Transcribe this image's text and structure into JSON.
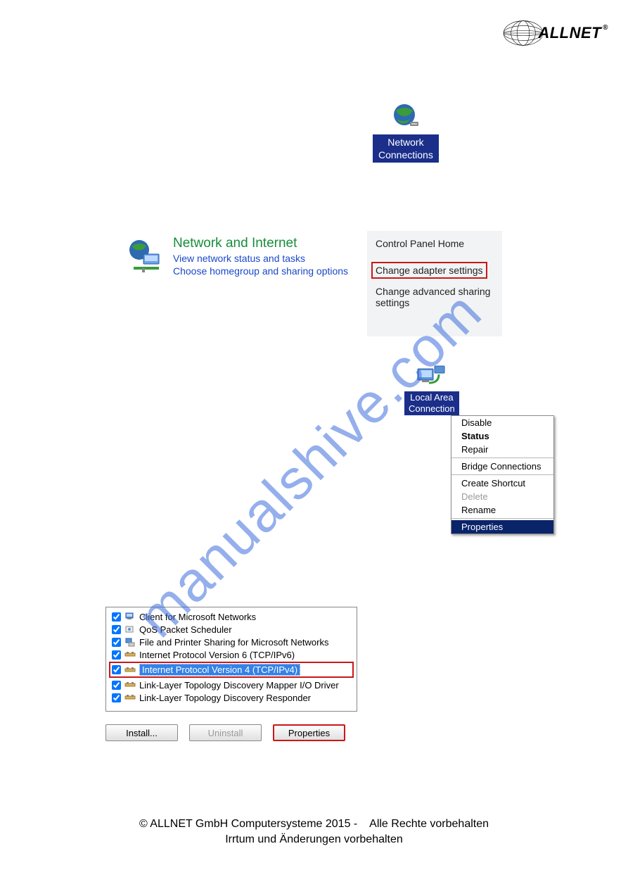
{
  "logo": {
    "brand": "ALLNET",
    "registered": "®"
  },
  "network_connections": {
    "line1": "Network",
    "line2": "Connections"
  },
  "network_internet": {
    "title": "Network and Internet",
    "link1": "View network status and tasks",
    "link2": "Choose homegroup and sharing options"
  },
  "control_panel_sidebar": {
    "home": "Control Panel Home",
    "adapter": "Change adapter settings",
    "advanced": "Change advanced sharing settings"
  },
  "lan": {
    "line1": "Local Area",
    "line2": "Connection"
  },
  "context_menu": {
    "disable": "Disable",
    "status": "Status",
    "repair": "Repair",
    "bridge": "Bridge Connections",
    "shortcut": "Create Shortcut",
    "delete": "Delete",
    "rename": "Rename",
    "properties": "Properties"
  },
  "protocols": [
    {
      "label": "Client for Microsoft Networks"
    },
    {
      "label": "QoS Packet Scheduler"
    },
    {
      "label": "File and Printer Sharing for Microsoft Networks"
    },
    {
      "label": "Internet Protocol Version 6 (TCP/IPv6)"
    },
    {
      "label": "Internet Protocol Version 4 (TCP/IPv4)"
    },
    {
      "label": "Link-Layer Topology Discovery Mapper I/O Driver"
    },
    {
      "label": "Link-Layer Topology Discovery Responder"
    }
  ],
  "buttons": {
    "install": "Install...",
    "uninstall": "Uninstall",
    "properties": "Properties"
  },
  "footer": {
    "line1_a": "© ALLNET GmbH Computersysteme 2015 -",
    "line1_b": "Alle Rechte vorbehalten",
    "line2": "Irrtum und Änderungen vorbehalten"
  },
  "watermark": "manualshive.com"
}
